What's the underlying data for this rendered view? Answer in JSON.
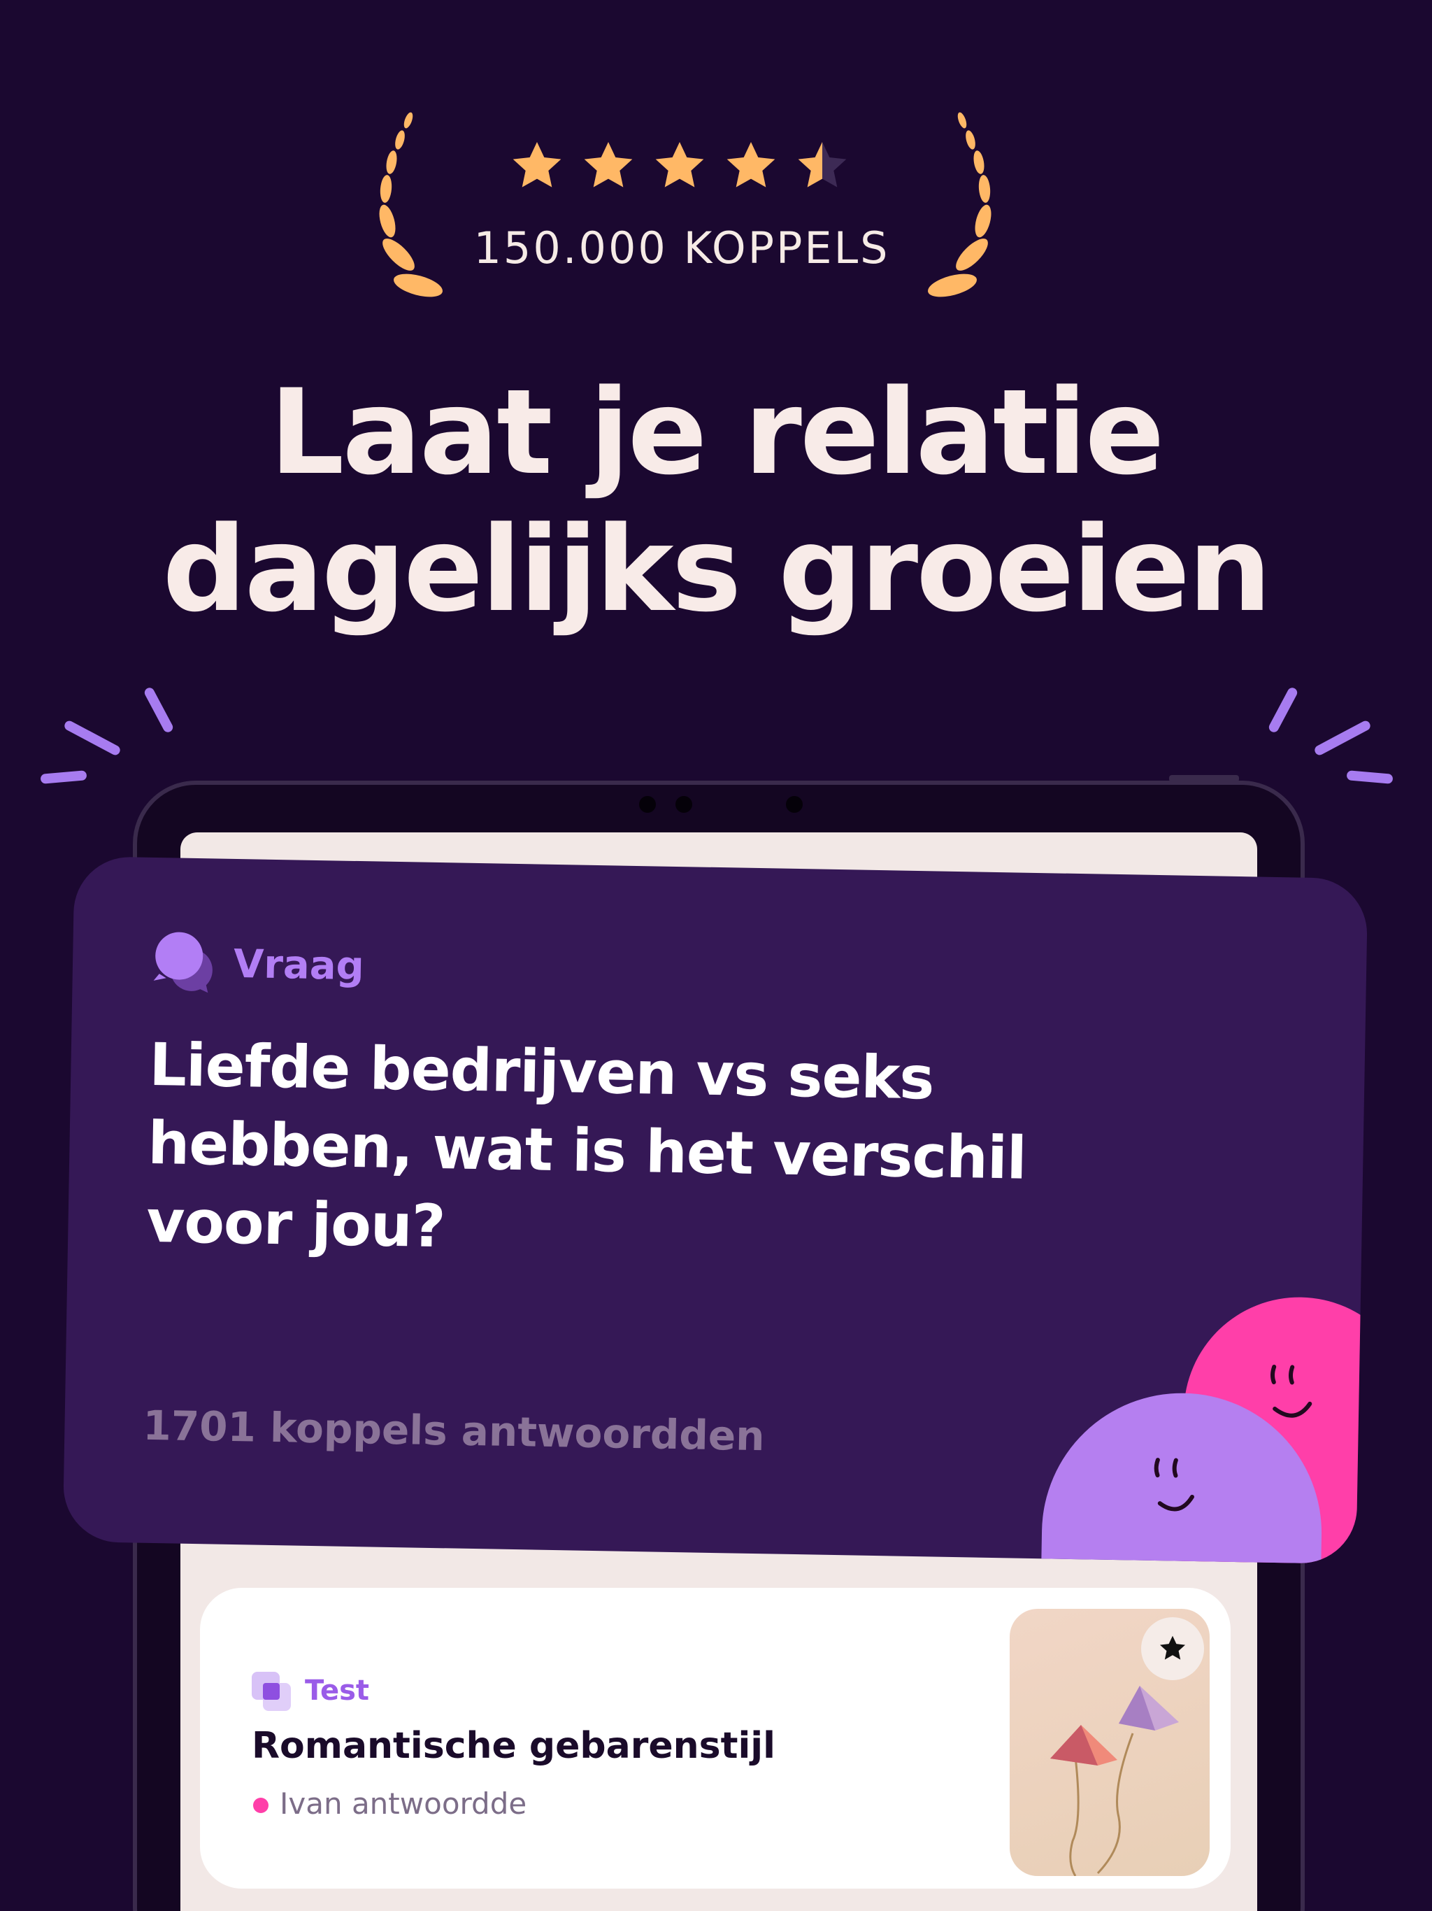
{
  "rating": {
    "stars": 4.5,
    "max_stars": 5,
    "star_color": "#ffb866",
    "count_label": "150.000 KOPPELS"
  },
  "headline": {
    "line1": "Laat je relatie",
    "line2": "dagelijks groeien"
  },
  "question_card": {
    "tag": "Vraag",
    "text": "Liefde bedrijven vs seks hebben, wat is het verschil voor jou?",
    "answer_count": "1701 koppels antwoordden"
  },
  "test_card": {
    "tag": "Test",
    "title": "Romantische gebarenstijl",
    "subtitle": "Ivan antwoordde"
  },
  "colors": {
    "background": "#1b0830",
    "card": "#351856",
    "accent_purple": "#b27ef5",
    "accent_pink": "#ff3fa9"
  },
  "icons": [
    "laurel-left-icon",
    "laurel-right-icon",
    "star-icon",
    "chat-bubbles-icon",
    "test-layers-icon",
    "favorite-star-icon"
  ]
}
